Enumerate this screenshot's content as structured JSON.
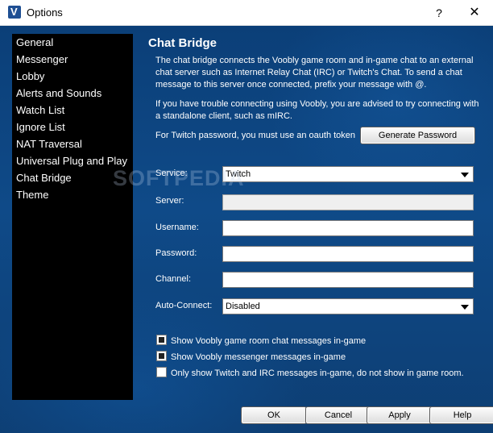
{
  "window": {
    "title": "Options",
    "help_glyph": "?",
    "close_glyph": "✕"
  },
  "nav": {
    "items": [
      {
        "label": "General"
      },
      {
        "label": "Messenger"
      },
      {
        "label": "Lobby"
      },
      {
        "label": "Alerts and Sounds"
      },
      {
        "label": "Watch List"
      },
      {
        "label": "Ignore List"
      },
      {
        "label": "NAT Traversal"
      },
      {
        "label": "Universal Plug and Play"
      },
      {
        "label": "Chat Bridge"
      },
      {
        "label": "Theme"
      }
    ]
  },
  "chat_bridge": {
    "heading": "Chat Bridge",
    "description": "The chat bridge connects the Voobly game room and in-game chat to an external chat server such as Internet Relay Chat (IRC) or Twitch's Chat. To send a chat message to this server once connected, prefix your message with @.",
    "trouble_note": "If you have trouble connecting using Voobly, you are advised to try connecting with a standalone client, such as mIRC.",
    "twitch_note": "For Twitch password, you must use an oauth token",
    "generate_password_label": "Generate Password",
    "service_label": "Service:",
    "service_value": "Twitch",
    "server_label": "Server:",
    "server_value": "",
    "username_label": "Username:",
    "username_value": "",
    "password_label": "Password:",
    "password_value": "",
    "channel_label": "Channel:",
    "channel_value": "",
    "auto_connect_label": "Auto-Connect:",
    "auto_connect_value": "Disabled",
    "options": [
      {
        "label": "Show Voobly game room chat messages in-game",
        "checked": true
      },
      {
        "label": "Show Voobly messenger messages in-game",
        "checked": true
      },
      {
        "label": "Only show Twitch and IRC messages in-game, do not show in game room.",
        "checked": false
      }
    ]
  },
  "footer": {
    "ok_label": "OK",
    "cancel_label": "Cancel",
    "apply_label": "Apply",
    "help_label": "Help"
  },
  "watermark": "SOFTPEDIA"
}
